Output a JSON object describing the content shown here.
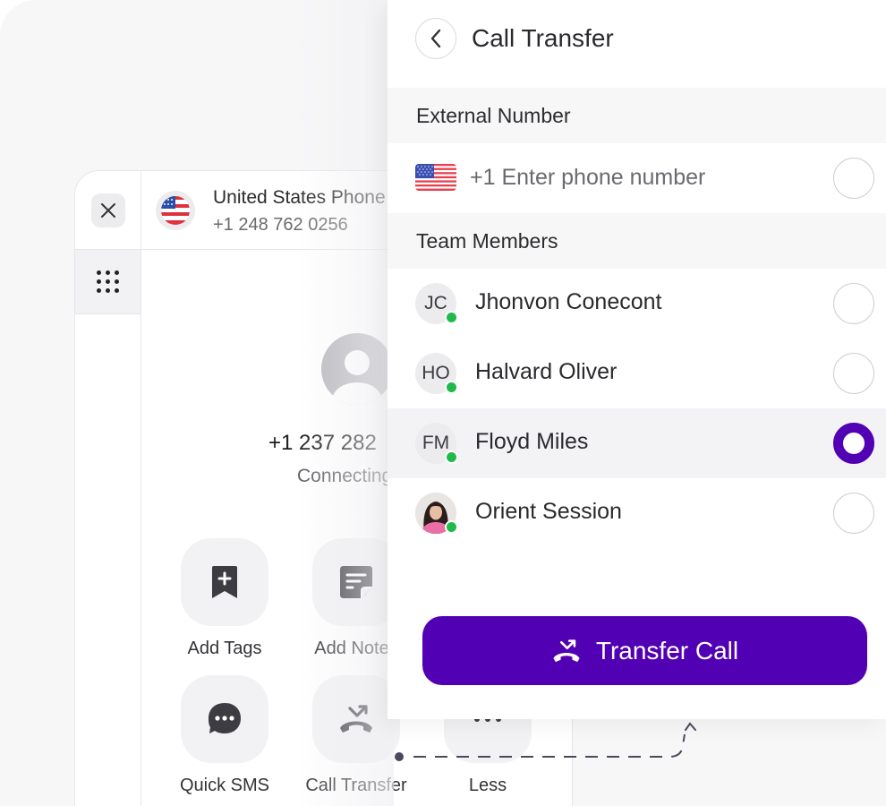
{
  "phone": {
    "line_name": "United States Phone",
    "line_number": "+1 248 762 0256",
    "caller_number": "+1 237 282",
    "caller_status": "Connecting",
    "actions": [
      {
        "label": "Add Tags",
        "icon": "bookmark-plus-icon"
      },
      {
        "label": "Add Notes",
        "icon": "note-icon"
      },
      {
        "label": "Quick SMS",
        "icon": "chat-bubble-icon"
      },
      {
        "label": "Call Transfer",
        "icon": "call-transfer-icon"
      },
      {
        "label": "Less",
        "icon": "more-dots-icon"
      }
    ]
  },
  "panel": {
    "title": "Call Transfer",
    "external_section": "External Number",
    "country_code": "+1",
    "phone_placeholder": "+1 Enter phone number",
    "team_section": "Team Members",
    "members": [
      {
        "initials": "JC",
        "name": "Jhonvon Conecont",
        "status": "online",
        "selected": false
      },
      {
        "initials": "HO",
        "name": "Halvard Oliver",
        "status": "online",
        "selected": false
      },
      {
        "initials": "FM",
        "name": "Floyd Miles",
        "status": "online",
        "selected": true
      },
      {
        "initials": "",
        "name": "Orient Session",
        "status": "online",
        "selected": false,
        "photo": true
      }
    ],
    "transfer_button": "Transfer Call"
  },
  "colors": {
    "accent": "#5200b3",
    "online": "#1fba4b",
    "icon_dark": "#3c3c42"
  }
}
